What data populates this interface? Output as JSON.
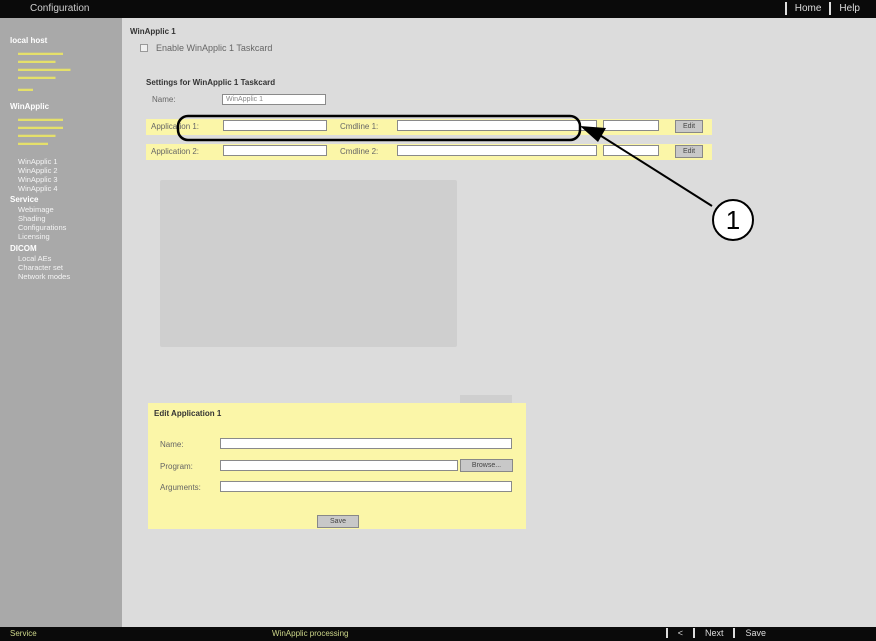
{
  "header": {
    "title": "Configuration",
    "nav": [
      "Home",
      "Help"
    ]
  },
  "sidebar": {
    "sections": [
      {
        "label": "local host"
      },
      {
        "label": "WinApplic"
      },
      {
        "label": "Service"
      },
      {
        "label": "DICOM"
      }
    ],
    "items": [
      "WinApplic 1",
      "WinApplic 2",
      "WinApplic 3",
      "WinApplic 4",
      "Webimage",
      "Shading",
      "Configurations",
      "Licensing",
      "Local AEs",
      "Character set",
      "Network modes"
    ]
  },
  "main": {
    "title": "WinApplic 1",
    "enable_label": "Enable WinApplic 1 Taskcard",
    "settings_title": "Settings for WinApplic 1 Taskcard",
    "name_label": "Name:",
    "name_value": "WinApplic 1",
    "app_rows": [
      {
        "app_label": "Application 1:",
        "cmd_label": "Cmdline 1:",
        "button": "Edit"
      },
      {
        "app_label": "Application 2:",
        "cmd_label": "Cmdline 2:",
        "button": "Edit"
      }
    ]
  },
  "edit_panel": {
    "title": "Edit Application 1",
    "name_label": "Name:",
    "program_label": "Program:",
    "browse_label": "Browse...",
    "arguments_label": "Arguments:",
    "save_label": "Save"
  },
  "footer": {
    "left": "Service",
    "middle": "WinApplic processing",
    "nav": [
      "<",
      "Next",
      "Save"
    ]
  },
  "annotation": {
    "marker": "1"
  }
}
